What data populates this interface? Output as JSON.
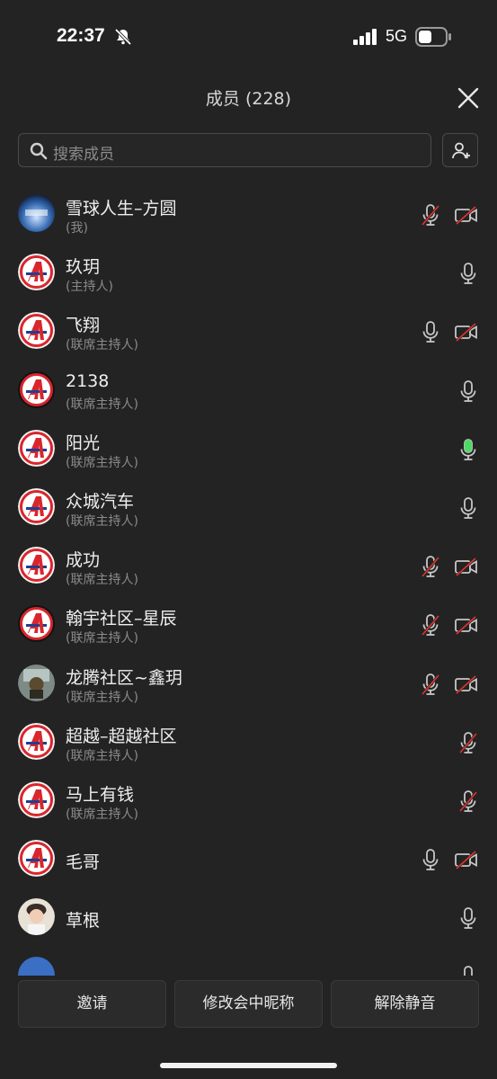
{
  "status": {
    "time": "22:37",
    "network": "5G"
  },
  "header": {
    "title": "成员 (228)"
  },
  "search": {
    "placeholder": "搜索成员"
  },
  "members": [
    {
      "name": "雪球人生–方圆",
      "role": "(我)",
      "avatar": "photo-snowball",
      "mic": "muted",
      "cam": "off"
    },
    {
      "name": "玖玥",
      "role": "(主持人)",
      "avatar": "logo-a",
      "mic": "on",
      "cam": null
    },
    {
      "name": "飞翔",
      "role": "(联席主持人)",
      "avatar": "logo-a",
      "mic": "on",
      "cam": "off"
    },
    {
      "name": "2138",
      "role": "(联席主持人)",
      "avatar": "logo-a-dark",
      "mic": "on",
      "cam": null
    },
    {
      "name": "阳光",
      "role": "(联席主持人)",
      "avatar": "logo-a",
      "mic": "speaking",
      "cam": null
    },
    {
      "name": "众城汽车",
      "role": "(联席主持人)",
      "avatar": "logo-a",
      "mic": "on",
      "cam": null
    },
    {
      "name": "成功",
      "role": "(联席主持人)",
      "avatar": "logo-a",
      "mic": "muted",
      "cam": "off"
    },
    {
      "name": "翰宇社区–星辰",
      "role": "(联席主持人)",
      "avatar": "logo-a-dark",
      "mic": "muted",
      "cam": "off"
    },
    {
      "name": "龙腾社区~鑫玥",
      "role": "(联席主持人)",
      "avatar": "photo-room",
      "mic": "muted",
      "cam": "off"
    },
    {
      "name": "超越–超越社区",
      "role": "(联席主持人)",
      "avatar": "logo-a",
      "mic": "muted",
      "cam": null
    },
    {
      "name": "马上有钱",
      "role": "(联席主持人)",
      "avatar": "logo-a",
      "mic": "muted",
      "cam": null
    },
    {
      "name": "毛哥",
      "role": "",
      "avatar": "logo-a",
      "mic": "on",
      "cam": "off"
    },
    {
      "name": "草根",
      "role": "",
      "avatar": "photo-person",
      "mic": "on",
      "cam": null
    },
    {
      "name": "",
      "role": "",
      "avatar": "partial-blue",
      "mic": "on",
      "cam": null
    }
  ],
  "actions": {
    "invite": "邀请",
    "rename": "修改会中昵称",
    "unmute": "解除静音"
  },
  "colors": {
    "background": "#232323",
    "speaking": "#4cd964",
    "muted_slash": "#e0342f",
    "logo_red": "#d9262c",
    "logo_blue": "#1f3f8f"
  }
}
